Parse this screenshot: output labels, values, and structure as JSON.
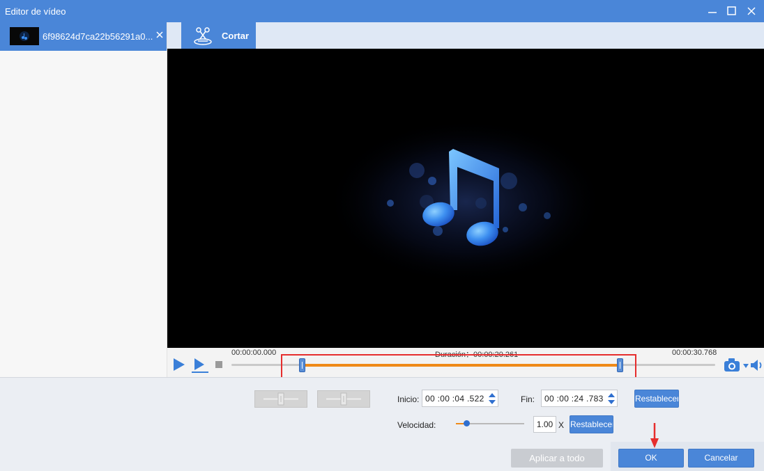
{
  "window": {
    "title": "Editor de vídeo"
  },
  "sidebar": {
    "file_name": "6f98624d7ca22b56291a0..."
  },
  "toolbar": {
    "cut_tab_label": "Cortar"
  },
  "timeline": {
    "start_time": "00:00:00.000",
    "duration_label": "Duración：00:00:20.261",
    "end_time": "00:00:30.768",
    "selection_start_fraction": 0.147,
    "selection_end_fraction": 0.805
  },
  "trim": {
    "start_label": "Inicio:",
    "start_value": "00 :00 :04 .522",
    "end_label": "Fin:",
    "end_value": "00 :00 :24 .783",
    "reset_label": "Restablecer"
  },
  "speed": {
    "label": "Velocidad:",
    "value": "1.00",
    "unit": "X",
    "reset_label": "Restablecer",
    "slider_fraction": 0.15
  },
  "footer": {
    "apply_all_label": "Aplicar a todo",
    "ok_label": "OK",
    "cancel_label": "Cancelar"
  },
  "colors": {
    "accent": "#4a86d8",
    "selection": "#ef8a18",
    "annotation": "#e62d2d"
  }
}
